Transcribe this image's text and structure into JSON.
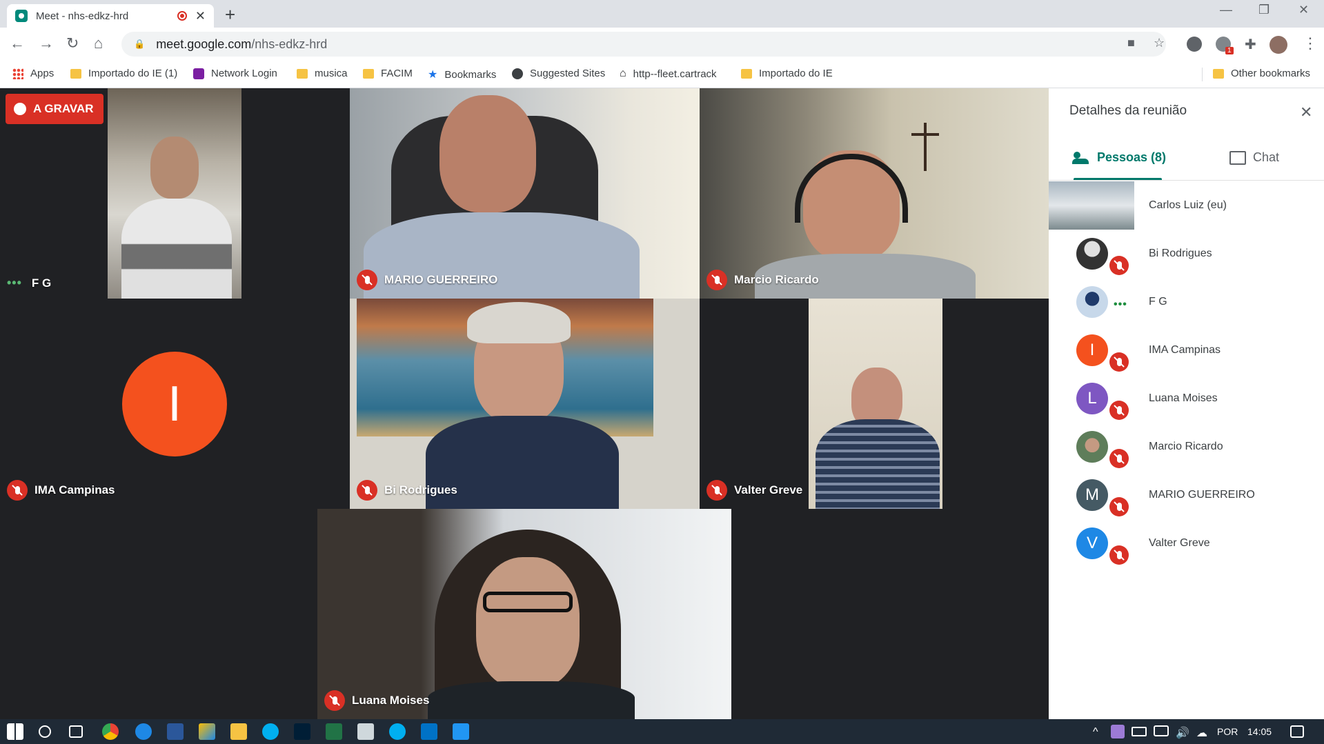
{
  "browser": {
    "tab_title": "Meet - nhs-edkz-hrd",
    "url_host": "meet.google.com",
    "url_path": "/nhs-edkz-hrd",
    "extension_badge": "1"
  },
  "bookmarks": [
    "Apps",
    "Importado do IE (1)",
    "Network Login",
    "musica",
    "FACIM",
    "Bookmarks",
    "Suggested Sites",
    "http--fleet.cartrack",
    "Importado do IE"
  ],
  "other_bookmarks": "Other bookmarks",
  "meeting": {
    "recording_label": "A GRAVAR",
    "tiles": [
      {
        "name": "F G"
      },
      {
        "name": "MARIO GUERREIRO"
      },
      {
        "name": "Marcio Ricardo"
      },
      {
        "name": "IMA Campinas",
        "avatar_letter": "I"
      },
      {
        "name": "Bi Rodrigues"
      },
      {
        "name": "Valter Greve"
      },
      {
        "name": "Luana Moises"
      }
    ]
  },
  "panel": {
    "title": "Detalhes da reunião",
    "tab_people": "Pessoas (8)",
    "tab_chat": "Chat",
    "participants": [
      {
        "name": "Carlos Luiz (eu)"
      },
      {
        "name": "Bi Rodrigues"
      },
      {
        "name": "F G"
      },
      {
        "name": "IMA Campinas",
        "letter": "I",
        "color": "#f4511e"
      },
      {
        "name": "Luana Moises",
        "letter": "L",
        "color": "#7e57c2"
      },
      {
        "name": "Marcio Ricardo"
      },
      {
        "name": "MARIO GUERREIRO",
        "letter": "M",
        "color": "#455a64"
      },
      {
        "name": "Valter Greve",
        "letter": "V",
        "color": "#1e88e5"
      }
    ]
  },
  "taskbar": {
    "language": "POR",
    "time": "14:05"
  },
  "colors": {
    "accent": "#00796b",
    "mic_off": "#d93025",
    "stage_bg": "#202124"
  }
}
